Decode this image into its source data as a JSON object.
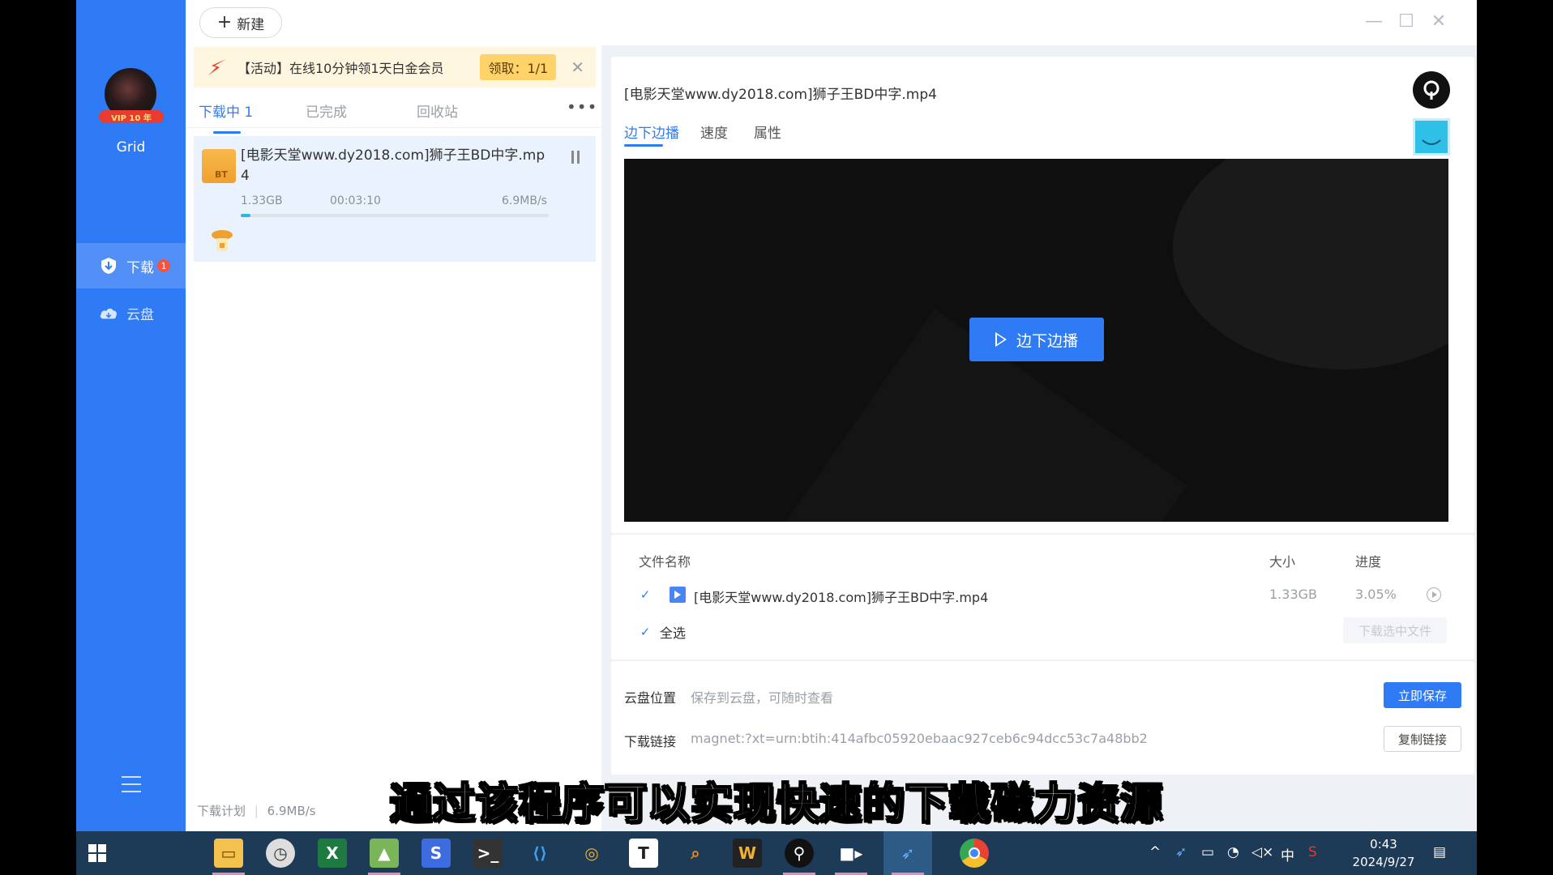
{
  "sidebar": {
    "vip_badge": "VIP 10 年",
    "user_name": "Grid",
    "nav": [
      {
        "label": "下载",
        "badge": "1"
      },
      {
        "label": "云盘"
      }
    ]
  },
  "topbar": {
    "new_button": "新建"
  },
  "promo": {
    "text": "【活动】在线10分钟领1天白金会员",
    "claim": "领取：1/1"
  },
  "task_tabs": [
    "下载中 1",
    "已完成",
    "回收站"
  ],
  "task": {
    "name": "[电影天堂www.dy2018.com]狮子王BD中字.mp4",
    "size": "1.33GB",
    "remaining": "00:03:10",
    "speed": "6.9MB/s",
    "progress": 0.0305,
    "type_label": "BT"
  },
  "footer": {
    "plan_label": "下载计划",
    "plan_speed": "6.9MB/s"
  },
  "detail": {
    "title": "[电影天堂www.dy2018.com]狮子王BD中字.mp4",
    "tabs": [
      "边下边播",
      "速度",
      "属性"
    ],
    "play_button": "边下边播"
  },
  "file_table": {
    "headers": {
      "name": "文件名称",
      "size": "大小",
      "progress": "进度"
    },
    "rows": [
      {
        "name": "[电影天堂www.dy2018.com]狮子王BD中字.mp4",
        "size": "1.33GB",
        "progress": "3.05%"
      }
    ],
    "select_all": "全选",
    "download_selected": "下载选中文件"
  },
  "cloud": {
    "location_label": "云盘位置",
    "location_hint": "保存到云盘，可随时查看",
    "save_button": "立即保存",
    "link_label": "下载链接",
    "link_value": "magnet:?xt=urn:btih:414afbc05920ebaac927ceb6c94dcc53c7a48bb2",
    "copy_button": "复制链接"
  },
  "subtitle": "通过该程序可以实现快速的下载磁力资源",
  "taskbar": {
    "time": "0:43",
    "date": "2024/9/27",
    "ime": "中"
  },
  "colors": {
    "accent": "#2f7bf5",
    "sidebar": "#2f7bf5",
    "taskbar": "#1d3a57",
    "progress": "#2bb5f0"
  }
}
